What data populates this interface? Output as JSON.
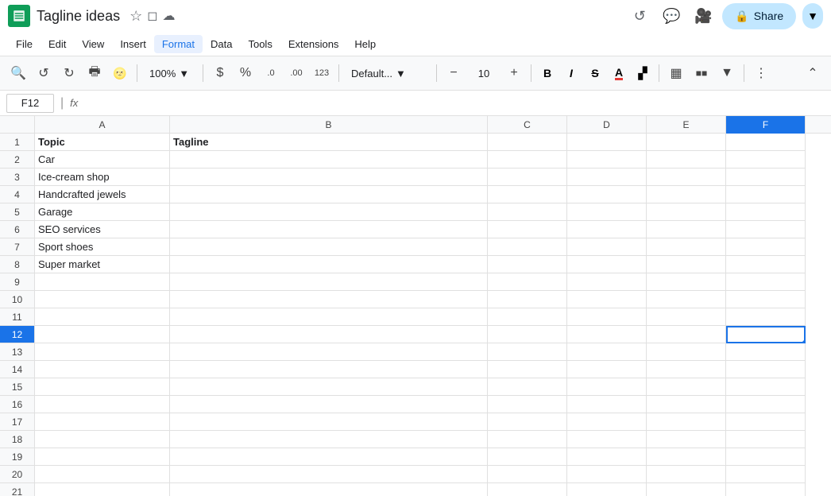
{
  "titleBar": {
    "docTitle": "Tagline ideas",
    "starLabel": "★",
    "driveLabel": "🗂",
    "cloudLabel": "☁"
  },
  "headerActions": {
    "historyIcon": "↺",
    "commentIcon": "💬",
    "videoIcon": "📹",
    "shareLabel": "Share"
  },
  "menuBar": {
    "items": [
      "File",
      "Edit",
      "View",
      "Insert",
      "Format",
      "Data",
      "Tools",
      "Extensions",
      "Help"
    ]
  },
  "toolbar": {
    "zoomLabel": "100%",
    "fontLabel": "Default...",
    "fontSize": "10",
    "currencyLabel": "$",
    "percentLabel": "%",
    "decDecrLabel": ".0",
    "decIncrLabel": ".00",
    "formatNumLabel": "123"
  },
  "formulaBar": {
    "cellRef": "F12",
    "fxLabel": "fx"
  },
  "columns": {
    "headers": [
      "A",
      "B",
      "C",
      "D",
      "E",
      "F"
    ]
  },
  "rows": [
    {
      "num": 1,
      "a": "Topic",
      "b": "Tagline",
      "c": "",
      "d": "",
      "e": "",
      "f": ""
    },
    {
      "num": 2,
      "a": "Car",
      "b": "",
      "c": "",
      "d": "",
      "e": "",
      "f": ""
    },
    {
      "num": 3,
      "a": "Ice-cream shop",
      "b": "",
      "c": "",
      "d": "",
      "e": "",
      "f": ""
    },
    {
      "num": 4,
      "a": "Handcrafted jewels",
      "b": "",
      "c": "",
      "d": "",
      "e": "",
      "f": ""
    },
    {
      "num": 5,
      "a": "Garage",
      "b": "",
      "c": "",
      "d": "",
      "e": "",
      "f": ""
    },
    {
      "num": 6,
      "a": "SEO services",
      "b": "",
      "c": "",
      "d": "",
      "e": "",
      "f": ""
    },
    {
      "num": 7,
      "a": "Sport shoes",
      "b": "",
      "c": "",
      "d": "",
      "e": "",
      "f": ""
    },
    {
      "num": 8,
      "a": "Super market",
      "b": "",
      "c": "",
      "d": "",
      "e": "",
      "f": ""
    },
    {
      "num": 9,
      "a": "",
      "b": "",
      "c": "",
      "d": "",
      "e": "",
      "f": ""
    },
    {
      "num": 10,
      "a": "",
      "b": "",
      "c": "",
      "d": "",
      "e": "",
      "f": ""
    },
    {
      "num": 11,
      "a": "",
      "b": "",
      "c": "",
      "d": "",
      "e": "",
      "f": ""
    },
    {
      "num": 12,
      "a": "",
      "b": "",
      "c": "",
      "d": "",
      "e": "",
      "f": "",
      "selected": true
    },
    {
      "num": 13,
      "a": "",
      "b": "",
      "c": "",
      "d": "",
      "e": "",
      "f": ""
    },
    {
      "num": 14,
      "a": "",
      "b": "",
      "c": "",
      "d": "",
      "e": "",
      "f": ""
    },
    {
      "num": 15,
      "a": "",
      "b": "",
      "c": "",
      "d": "",
      "e": "",
      "f": ""
    },
    {
      "num": 16,
      "a": "",
      "b": "",
      "c": "",
      "d": "",
      "e": "",
      "f": ""
    },
    {
      "num": 17,
      "a": "",
      "b": "",
      "c": "",
      "d": "",
      "e": "",
      "f": ""
    },
    {
      "num": 18,
      "a": "",
      "b": "",
      "c": "",
      "d": "",
      "e": "",
      "f": ""
    },
    {
      "num": 19,
      "a": "",
      "b": "",
      "c": "",
      "d": "",
      "e": "",
      "f": ""
    },
    {
      "num": 20,
      "a": "",
      "b": "",
      "c": "",
      "d": "",
      "e": "",
      "f": ""
    },
    {
      "num": 21,
      "a": "",
      "b": "",
      "c": "",
      "d": "",
      "e": "",
      "f": ""
    }
  ],
  "colors": {
    "accent": "#1a73e8",
    "green": "#0f9d58",
    "headerBg": "#f8f9fa",
    "shareBtn": "#c2e7ff"
  }
}
